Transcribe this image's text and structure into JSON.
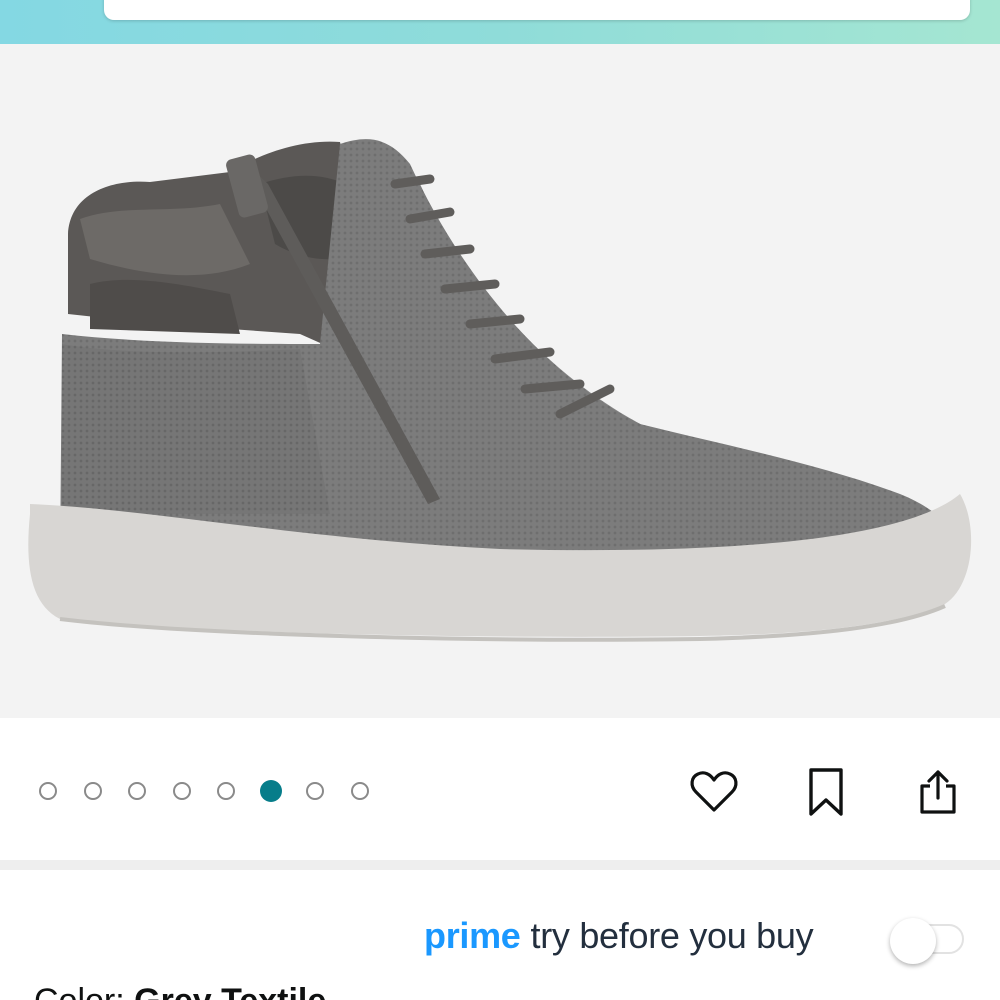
{
  "header": {
    "search": {
      "placeholder": ""
    }
  },
  "product_image": {
    "description_icon": "sneaker-image",
    "background": "#f3f3f3"
  },
  "carousel": {
    "total": 8,
    "active_index": 5,
    "active_color": "#067d8a"
  },
  "actions": {
    "favorite_icon": "heart-icon",
    "save_icon": "bookmark-icon",
    "share_icon": "share-icon"
  },
  "prime": {
    "brand": "prime",
    "label": "try before you buy",
    "brand_color": "#1a98ff",
    "toggle_on": false
  },
  "color": {
    "label": "Color:",
    "value": "Grey Textile"
  }
}
